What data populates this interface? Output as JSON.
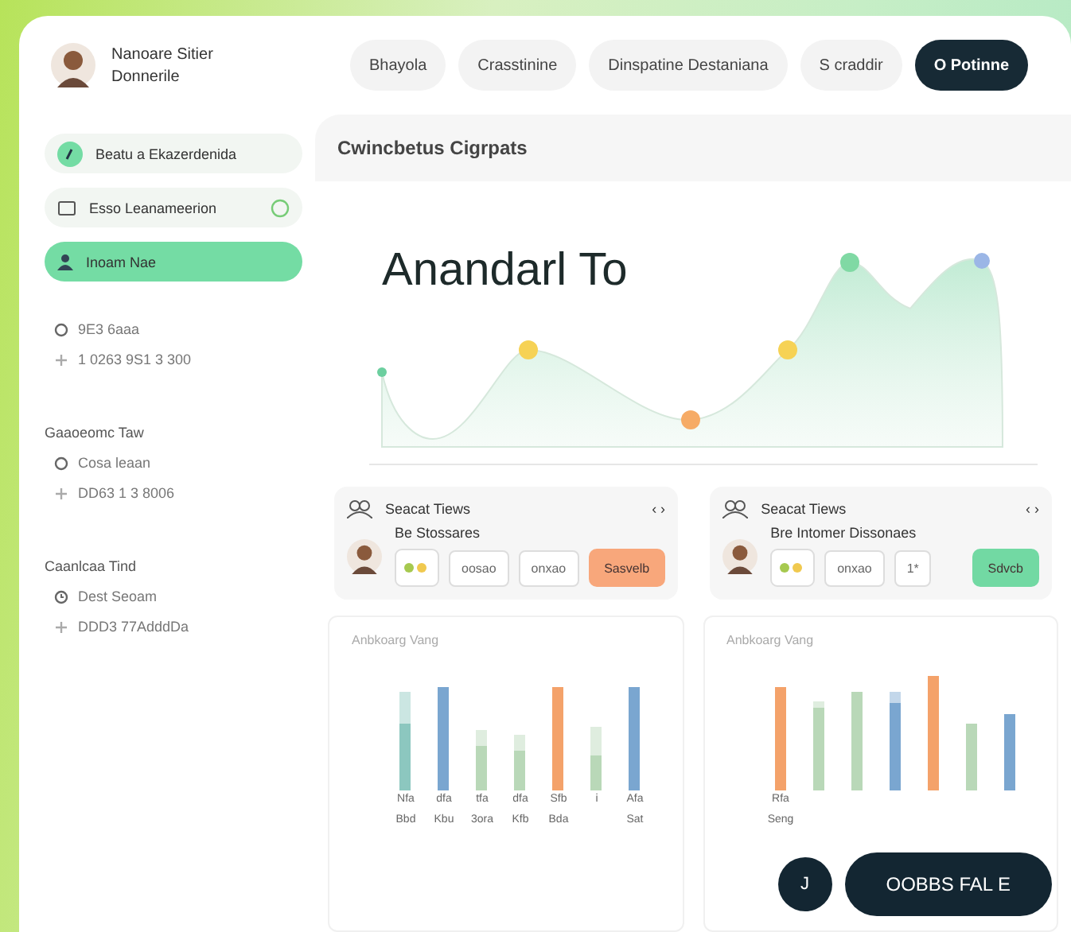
{
  "profile": {
    "name": "Nanoare Sitier",
    "role": "Donnerile"
  },
  "nav": [
    {
      "label": "Bhayola",
      "selected": false
    },
    {
      "label": "Crasstinine",
      "selected": false
    },
    {
      "label": "Dinspatine Destaniana",
      "selected": false
    },
    {
      "label": "S craddir",
      "selected": false
    },
    {
      "label": "O Potinne",
      "selected": true
    }
  ],
  "sidebar": {
    "items": [
      {
        "label": "Beatu a Ekazerdenida",
        "kind": "badge",
        "selected": false
      },
      {
        "label": "Esso Leanameerion",
        "kind": "toggle",
        "selected": false
      },
      {
        "label": "Inoam Nae",
        "kind": "user",
        "selected": true
      }
    ],
    "groups": [
      {
        "rows": [
          {
            "kind": "circle",
            "text": "9E3 6aaa"
          },
          {
            "kind": "plus",
            "text": "1 0263 9S1 3 300"
          }
        ]
      },
      {
        "heading": "Gaaoeomc Taw",
        "rows": [
          {
            "kind": "circle",
            "text": "Cosa leaan"
          },
          {
            "kind": "plus",
            "text": "DD63   1 3 8006"
          }
        ]
      },
      {
        "heading": "Caanlcaa Tind",
        "rows": [
          {
            "kind": "clock",
            "text": "Dest Seoam"
          },
          {
            "kind": "plus",
            "text": "DDD3  77AdddDa"
          }
        ]
      }
    ]
  },
  "main": {
    "title": "Cwincbetus Cigrpats",
    "hero": "Anandarl To"
  },
  "cards": [
    {
      "title": "Seacat Tiews",
      "pager": "‹ ›",
      "subtitle": "Be Stossares",
      "fields": [
        "oosao",
        "onxao"
      ],
      "action": "Sasvelb",
      "color": "#f8a77b"
    },
    {
      "title": "Seacat Tiews",
      "pager": "‹ ›",
      "subtitle": "Bre  Intomer Dissonaes",
      "fields": [
        "onxao",
        "1*"
      ],
      "action": "Sdvcb",
      "color": "#72d9a3"
    }
  ],
  "charts": [
    {
      "title": "Anbkoarg Vang",
      "labels": [
        [
          "Nfa",
          "Bbd"
        ],
        [
          "dfa",
          "Kbu"
        ],
        [
          "tfa",
          "3ora"
        ],
        [
          "dfa",
          "Kfb"
        ],
        [
          "Sfb",
          "Bda"
        ],
        [
          "i"
        ],
        [
          "Afa",
          "Sat"
        ]
      ]
    },
    {
      "title": "Anbkoarg Vang",
      "labels": [
        [
          "Rfa",
          "Seng"
        ]
      ]
    }
  ],
  "fab": {
    "count": "J",
    "label": "OOBBS FAL E"
  }
}
